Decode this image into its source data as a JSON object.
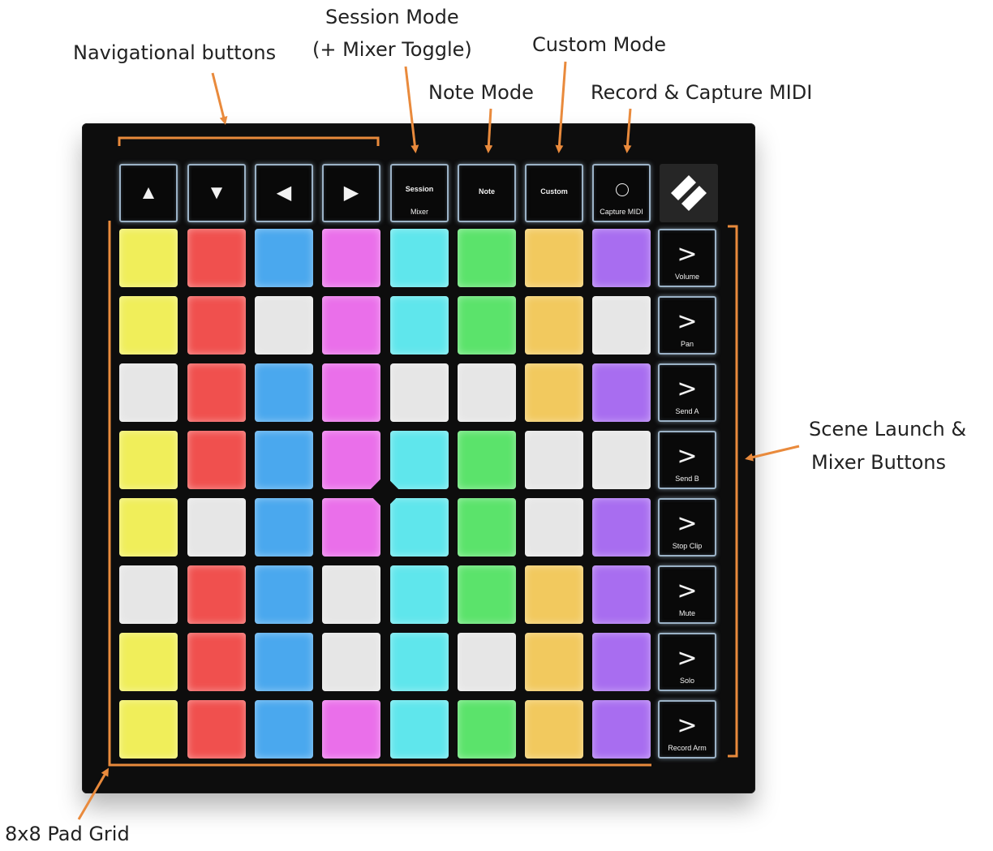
{
  "callouts": {
    "navigational": "Navigational buttons",
    "session_line1": "Session Mode",
    "session_line2": "(+ Mixer Toggle)",
    "custom": "Custom Mode",
    "note": "Note Mode",
    "record": "Record & Capture MIDI",
    "scene_line1": "Scene Launch &",
    "scene_line2": "Mixer Buttons",
    "grid": "8x8 Pad Grid"
  },
  "top_buttons": [
    {
      "kind": "arrow",
      "label": "▲",
      "icon": "arrow-up-icon"
    },
    {
      "kind": "arrow",
      "label": "▼",
      "icon": "arrow-down-icon"
    },
    {
      "kind": "arrow",
      "label": "◀",
      "icon": "arrow-left-icon"
    },
    {
      "kind": "arrow",
      "label": "▶",
      "icon": "arrow-right-icon"
    },
    {
      "kind": "text",
      "label": "Session",
      "sub": "Mixer"
    },
    {
      "kind": "text",
      "label": "Note",
      "sub": ""
    },
    {
      "kind": "text",
      "label": "Custom",
      "sub": ""
    },
    {
      "kind": "circle",
      "label": "",
      "sub": "Capture MIDI",
      "icon": "circle-icon"
    }
  ],
  "scene_buttons": [
    {
      "glyph": ">",
      "label": "Volume"
    },
    {
      "glyph": ">",
      "label": "Pan"
    },
    {
      "glyph": ">",
      "label": "Send A"
    },
    {
      "glyph": ">",
      "label": "Send B"
    },
    {
      "glyph": ">",
      "label": "Stop Clip"
    },
    {
      "glyph": ">",
      "label": "Mute"
    },
    {
      "glyph": ">",
      "label": "Solo"
    },
    {
      "glyph": ">",
      "label": "Record Arm"
    }
  ],
  "colors": {
    "Y": "#f0ee5a",
    "R": "#f0504e",
    "B": "#4aa8ee",
    "M": "#ea6fea",
    "C": "#5fe6ec",
    "G": "#5be36b",
    "O": "#f2c95e",
    "P": "#a86df0",
    "W": "#e6e6e6",
    "accent": "#e98a3c"
  },
  "pad_grid": [
    [
      "Y",
      "R",
      "B",
      "M",
      "C",
      "G",
      "O",
      "P"
    ],
    [
      "Y",
      "R",
      "W",
      "M",
      "C",
      "G",
      "O",
      "W"
    ],
    [
      "W",
      "R",
      "B",
      "M",
      "W",
      "W",
      "O",
      "P"
    ],
    [
      "Y",
      "R",
      "B",
      "M",
      "C",
      "G",
      "W",
      "W"
    ],
    [
      "Y",
      "W",
      "B",
      "M",
      "C",
      "G",
      "W",
      "P"
    ],
    [
      "W",
      "R",
      "B",
      "W",
      "C",
      "G",
      "O",
      "P"
    ],
    [
      "Y",
      "R",
      "B",
      "W",
      "C",
      "W",
      "O",
      "P"
    ],
    [
      "Y",
      "R",
      "B",
      "M",
      "C",
      "G",
      "O",
      "P"
    ]
  ]
}
